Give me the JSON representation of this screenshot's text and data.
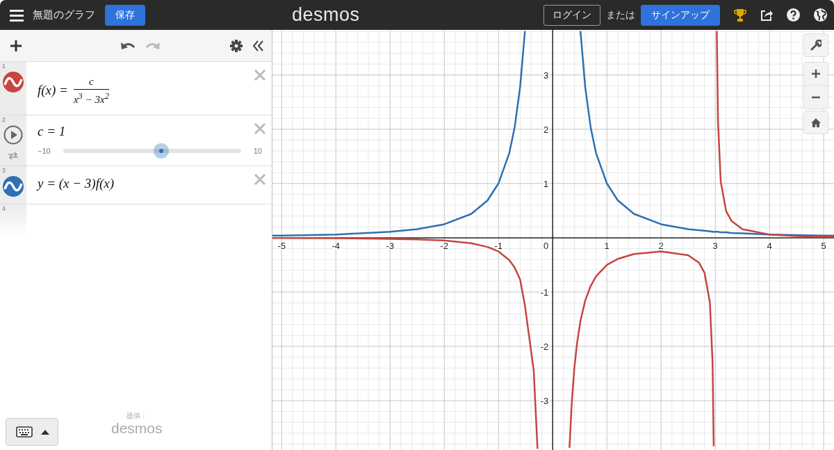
{
  "topbar": {
    "title": "無題のグラフ",
    "save": "保存",
    "logo": "desmos",
    "login": "ログイン",
    "or": "または",
    "signup": "サインアップ"
  },
  "expressions": [
    {
      "kind": "fraction",
      "index": "1",
      "color": "#c74440",
      "lhs": "f(x) =",
      "numerator": "c",
      "denominator": "x$^{3}$ − 3x$^{2}$"
    },
    {
      "kind": "slider",
      "index": "2",
      "text": "c = 1",
      "min": "−10",
      "max": "10",
      "level": 0.55
    },
    {
      "kind": "expression",
      "index": "3",
      "color": "#2d70b3",
      "text": "y = (x − 3)f(x)"
    },
    {
      "kind": "empty",
      "index": "4"
    }
  ],
  "footer": {
    "powered_by": "提供：",
    "logo": "desmos"
  },
  "graph": {
    "chart_data": {
      "type": "line",
      "grid": true,
      "xlim": [
        -5.17,
        5.19
      ],
      "ylim": [
        -3.91,
        3.83
      ],
      "xticks": [
        {
          "value": -5,
          "label": "-5"
        },
        {
          "value": -4,
          "label": "-4"
        },
        {
          "value": -3,
          "label": "-3"
        },
        {
          "value": -2,
          "label": "-2"
        },
        {
          "value": -1,
          "label": "-1"
        },
        {
          "value": 0,
          "label": "0"
        },
        {
          "value": 1,
          "label": "1"
        },
        {
          "value": 2,
          "label": "2"
        },
        {
          "value": 3,
          "label": "3"
        },
        {
          "value": 4,
          "label": "4"
        },
        {
          "value": 5,
          "label": "5"
        }
      ],
      "yticks": [
        {
          "value": -3,
          "label": "-3"
        },
        {
          "value": -2,
          "label": "-2"
        },
        {
          "value": -1,
          "label": "-1"
        },
        {
          "value": 1,
          "label": "1"
        },
        {
          "value": 2,
          "label": "2"
        },
        {
          "value": 3,
          "label": "3"
        }
      ],
      "x": [
        -5.17,
        -5,
        -4,
        -3,
        -2.5,
        -2,
        -1.5,
        -1.2,
        -1,
        -0.8,
        -0.7,
        -0.6,
        -0.512,
        -0.35,
        -0.28,
        0,
        0.31,
        0.35,
        0.4,
        0.45,
        0.512,
        0.6,
        0.7,
        0.8,
        1,
        1.2,
        1.5,
        2,
        2.5,
        2.7,
        2.8,
        2.9,
        2.95,
        2.9705,
        3,
        3.0286,
        3.05,
        3.1,
        3.2,
        3.3,
        3.5,
        4,
        4.5,
        5,
        5.19
      ],
      "series": [
        {
          "color": "#2d70b3",
          "values": [
            0.04,
            0.04,
            0.06,
            0.11,
            0.16,
            0.25,
            0.44,
            0.69,
            1,
            1.56,
            2.04,
            2.78,
            3.81,
            null,
            null,
            null,
            null,
            null,
            null,
            null,
            3.81,
            2.78,
            2.04,
            1.56,
            1,
            0.69,
            0.44,
            0.25,
            0.16,
            0.14,
            0.13,
            0.12,
            0.11,
            0.11,
            0.11,
            0.11,
            0.11,
            0.1,
            0.1,
            0.09,
            0.08,
            0.06,
            0.05,
            0.04,
            0.04
          ]
        },
        {
          "color": "#c74440",
          "values": [
            -0.005,
            -0.005,
            -0.009,
            -0.02,
            -0.03,
            -0.05,
            -0.1,
            -0.17,
            -0.25,
            -0.41,
            -0.55,
            -0.77,
            -1.25,
            -2.44,
            -3.89,
            null,
            -3.87,
            -3.08,
            -2.4,
            -1.94,
            -1.53,
            -1.16,
            -0.89,
            -0.71,
            -0.5,
            -0.39,
            -0.3,
            -0.25,
            -0.32,
            -0.46,
            -0.64,
            -1.19,
            -2.3,
            -3.84,
            null,
            3.81,
            2.15,
            1.04,
            0.49,
            0.31,
            0.16,
            0.06,
            0.03,
            0.02,
            0.02
          ]
        }
      ]
    }
  }
}
